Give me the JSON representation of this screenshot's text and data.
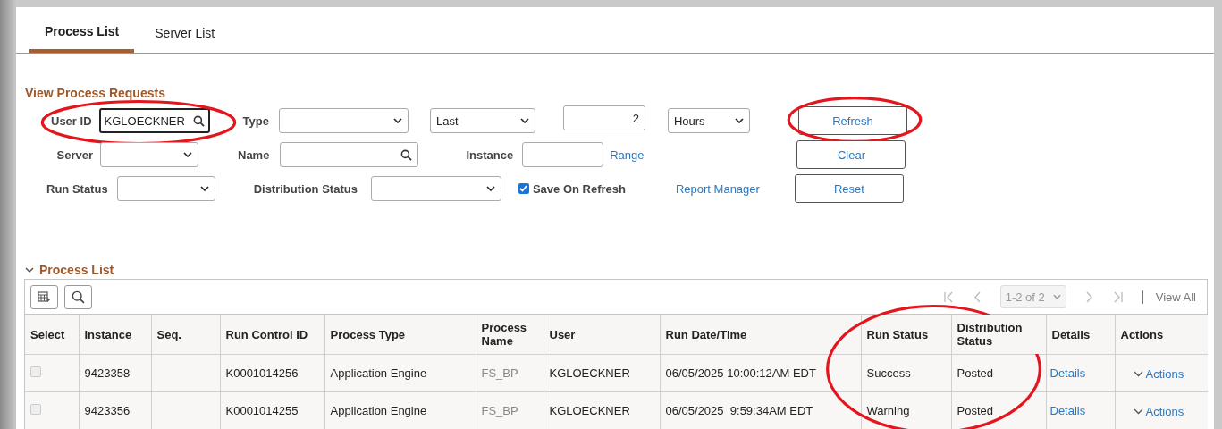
{
  "tabs": [
    {
      "label": "Process List",
      "selected": true
    },
    {
      "label": "Server List",
      "selected": false
    }
  ],
  "heading": "View Process Requests",
  "filters": {
    "user_id": {
      "label": "User ID",
      "value": "KGLOECKNER",
      "circled": true
    },
    "type": {
      "label": "Type"
    },
    "period": {
      "value": "Last"
    },
    "amount": {
      "value": "2"
    },
    "unit": {
      "value": "Hours"
    },
    "server": {
      "label": "Server"
    },
    "name": {
      "label": "Name"
    },
    "instance": {
      "label": "Instance"
    },
    "range_link": "Range",
    "run_status": {
      "label": "Run Status"
    },
    "distribution_status": {
      "label": "Distribution Status"
    },
    "save_on_refresh": {
      "label": "Save On Refresh",
      "checked": true
    },
    "report_manager_link": "Report Manager"
  },
  "buttons": [
    {
      "label": "Refresh",
      "circled": true
    },
    {
      "label": "Clear",
      "circled": false
    },
    {
      "label": "Reset",
      "circled": false
    }
  ],
  "process_list": {
    "title": "Process List",
    "expanded": true,
    "pager": "1-2 of 2",
    "view_all": "View All",
    "columns": [
      {
        "label": "Select",
        "circled": false
      },
      {
        "label": "Instance",
        "circled": false
      },
      {
        "label": "Seq.",
        "circled": false
      },
      {
        "label": "Run Control ID",
        "circled": false
      },
      {
        "label": "Process Type",
        "circled": false
      },
      {
        "label": "Process Name",
        "circled": false
      },
      {
        "label": "User",
        "circled": false
      },
      {
        "label": "Run Date/Time",
        "circled": false
      },
      {
        "label": "Run Status",
        "circled": true
      },
      {
        "label": "Distribution Status",
        "circled": true
      },
      {
        "label": "Details",
        "circled": false
      },
      {
        "label": "Actions",
        "circled": false
      }
    ],
    "rows": [
      {
        "selected": false,
        "disabled": true,
        "instance": "9423358",
        "run_control_id": "K0001014256",
        "process_type": "Application Engine",
        "process_name": "FS_BP",
        "user": "KGLOECKNER",
        "run_date_time": "06/05/2025 10:00:12AM EDT",
        "run_status": "Success",
        "distribution_status": "Posted",
        "details": "Details",
        "actions": "Actions"
      },
      {
        "selected": false,
        "disabled": true,
        "instance": "9423356",
        "run_control_id": "K0001014255",
        "process_type": "Application Engine",
        "process_name": "FS_BP",
        "user": "KGLOECKNER",
        "run_date_time": "06/05/2025  9:59:34AM EDT",
        "run_status": "Warning",
        "distribution_status": "Posted",
        "details": "Details",
        "actions": "Actions"
      }
    ]
  }
}
